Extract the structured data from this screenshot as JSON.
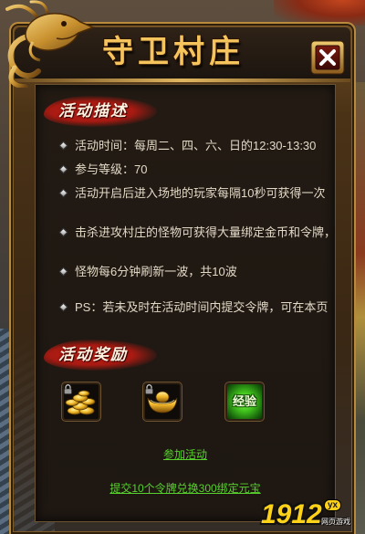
{
  "dialog": {
    "title": "守卫村庄",
    "close_icon": "close-icon"
  },
  "description": {
    "header": "活动描述",
    "items": [
      "活动时间：每周二、四、六、日的12:30-13:30",
      "参与等级：70",
      "活动开启后进入场地的玩家每隔10秒可获得一次",
      "击杀进攻村庄的怪物可获得大量绑定金币和令牌，",
      "怪物每6分钟刷新一波，共10波",
      "PS：若未及时在活动时间内提交令牌，可在本页"
    ]
  },
  "rewards": {
    "header": "活动奖励",
    "items": [
      {
        "icon": "gold-coins-icon",
        "locked": true
      },
      {
        "icon": "gold-ingot-icon",
        "locked": true
      },
      {
        "icon": "experience-icon",
        "label": "经验",
        "locked": false
      }
    ]
  },
  "links": {
    "join": "参加活动",
    "exchange": "提交10个令牌兑换300绑定元宝"
  },
  "logo": {
    "number": "1912",
    "badge": "yx",
    "tagline": "网页游戏"
  },
  "colors": {
    "title_gold": "#f6c45c",
    "link_green": "#57d12c",
    "banner_red": "#a81a12",
    "text_cream": "#e2d9c6",
    "panel_bg": "#1e1712"
  }
}
